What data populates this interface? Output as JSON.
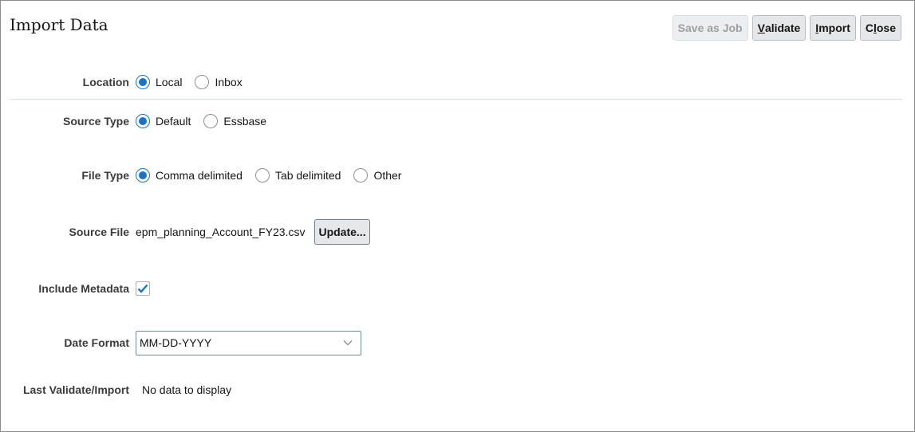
{
  "title": "Import Data",
  "buttons": {
    "save_as_job": "Save as Job",
    "validate": {
      "pre": "",
      "key": "V",
      "post": "alidate"
    },
    "import": {
      "pre": "",
      "key": "I",
      "post": "mport"
    },
    "close": {
      "pre": "C",
      "key": "l",
      "post": "ose"
    }
  },
  "location": {
    "label": "Location",
    "options": [
      "Local",
      "Inbox"
    ],
    "selected": "Local"
  },
  "source_type": {
    "label": "Source Type",
    "options": [
      "Default",
      "Essbase"
    ],
    "selected": "Default"
  },
  "file_type": {
    "label": "File Type",
    "options": [
      "Comma delimited",
      "Tab delimited",
      "Other"
    ],
    "selected": "Comma delimited"
  },
  "source_file": {
    "label": "Source File",
    "value": "epm_planning_Account_FY23.csv",
    "button": "Update..."
  },
  "include_metadata": {
    "label": "Include Metadata",
    "checked": true
  },
  "date_format": {
    "label": "Date Format",
    "value": "MM-DD-YYYY"
  },
  "last_validate": {
    "label": "Last Validate/Import",
    "value": "No data to display"
  },
  "colors": {
    "accent": "#1a73c7"
  }
}
